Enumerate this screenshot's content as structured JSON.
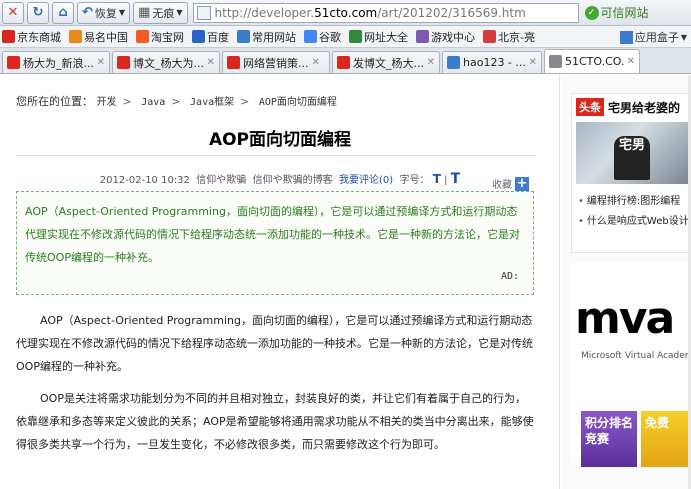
{
  "navbar": {
    "recover_label": "恢复",
    "incognito_label": "无痕",
    "url_prefix": "http://developer.",
    "url_domain": "51cto.com",
    "url_path": "/art/201202/316569.htm",
    "trusted_label": "可信网站"
  },
  "favorites": [
    {
      "label": "京东商城",
      "color": "#d9271d",
      "icon": "jd-icon"
    },
    {
      "label": "易名中国",
      "color": "#e8891d",
      "icon": "ename-icon"
    },
    {
      "label": "淘宝网",
      "color": "#f15a22",
      "icon": "taobao-icon"
    },
    {
      "label": "百度",
      "color": "#2d62c9",
      "icon": "baidu-icon"
    },
    {
      "label": "常用网站",
      "color": "#3a7ec9",
      "icon": "star-icon"
    },
    {
      "label": "谷歌",
      "color": "#4285f4",
      "icon": "google-icon"
    },
    {
      "label": "网址大全",
      "color": "#2f8a3c",
      "icon": "site-nav-icon"
    },
    {
      "label": "游戏中心",
      "color": "#7a5bb0",
      "icon": "game-icon"
    },
    {
      "label": "北京-亮",
      "color": "#d33c3c",
      "icon": "weather-icon"
    }
  ],
  "favorites_right": {
    "label": "应用盒子"
  },
  "tabs": [
    {
      "label": "杨大为_新浪...",
      "color": "#d9271d"
    },
    {
      "label": "博文_杨大为...",
      "color": "#d9271d"
    },
    {
      "label": "网络营销策...",
      "color": "#d9271d"
    },
    {
      "label": "发博文_杨大...",
      "color": "#d9271d"
    },
    {
      "label": "hao123 - ...",
      "color": "#3a7ec9"
    },
    {
      "label": "51CTO.CO...",
      "color": "#888888"
    }
  ],
  "breadcrumb": {
    "prefix": "您所在的位置：",
    "items": [
      "开发",
      "Java",
      "Java框架",
      "AOP面向切面编程"
    ]
  },
  "article": {
    "title": "AOP面向切面编程",
    "meta_date": "2012-02-10 10:32",
    "meta_author": "信仰や欺骗",
    "meta_source": "信仰や欺骗的博客",
    "meta_comment": "我要评论(0)",
    "meta_font_label": "字号：",
    "meta_font_t": "T",
    "collect_label": "收藏",
    "summary": "AOP（Aspect-Oriented Programming，面向切面的编程），它是可以通过预编译方式和运行期动态代理实现在不修改源代码的情况下给程序动态统一添加功能的一种技术。它是一种新的方法论，它是对传统OOP编程的一种补充。",
    "ad_label": "AD:",
    "para1": "AOP（Aspect-Oriented Programming，面向切面的编程），它是可以通过预编译方式和运行期动态代理实现在不修改源代码的情况下给程序动态统一添加功能的一种技术。它是一种新的方法论，它是对传统OOP编程的一种补充。",
    "para2": "OOP是关注将需求功能划分为不同的并且相对独立，封装良好的类，并让它们有着属于自己的行为，依靠继承和多态等来定义彼此的关系；AOP是希望能够将通用需求功能从不相关的类当中分离出来，能够使得很多类共享一个行为，一旦发生变化，不必修改很多类，而只需要修改这个行为即可。"
  },
  "sidebar": {
    "tag": "头条",
    "headline": "宅男给老婆的",
    "image_text": "宅男",
    "list": [
      "编程排行榜:图形编程",
      "什么是响应式Web设计"
    ],
    "mva_logo": "mva",
    "mva_sub": "Microsoft Virtual Academy",
    "tile1": "积分排名竞赛",
    "tile2": "免费"
  }
}
